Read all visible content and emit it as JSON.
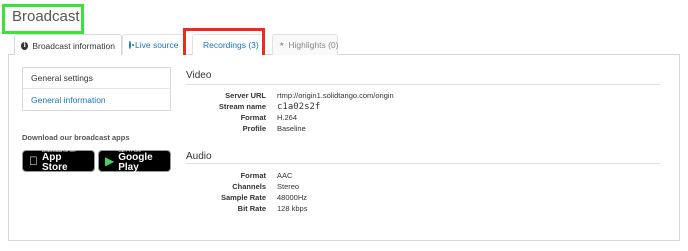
{
  "page": {
    "title": "Broadcast"
  },
  "tabs": [
    {
      "label": "Broadcast information",
      "icon": "info-icon",
      "state": "active"
    },
    {
      "label": "Live source",
      "icon": "live-source-icon",
      "state": "link"
    },
    {
      "label": "Recordings (3)",
      "icon": "recordings-icon",
      "state": "link"
    },
    {
      "label": "Highlights (0)",
      "icon": "star-icon",
      "state": "disabled"
    }
  ],
  "sidebar": {
    "items": [
      {
        "label": "General settings"
      },
      {
        "label": "General information"
      }
    ]
  },
  "apps": {
    "title": "Download our broadcast apps",
    "apple": {
      "small": "Download on the",
      "big": "App Store"
    },
    "google": {
      "small": "GET IT ON",
      "big": "Google Play"
    }
  },
  "video": {
    "title": "Video",
    "rows": [
      {
        "key": "Server URL",
        "value": "rtmp://origin1.solidtango.com/origin"
      },
      {
        "key": "Stream name",
        "value": "c1a02s2f"
      },
      {
        "key": "Format",
        "value": "H.264"
      },
      {
        "key": "Profile",
        "value": "Baseline"
      }
    ]
  },
  "audio": {
    "title": "Audio",
    "rows": [
      {
        "key": "Format",
        "value": "AAC"
      },
      {
        "key": "Channels",
        "value": "Stereo"
      },
      {
        "key": "Sample Rate",
        "value": "48000Hz"
      },
      {
        "key": "Bit Rate",
        "value": "128 kbps"
      }
    ]
  },
  "colors": {
    "link": "#1b75bb",
    "highlight_green": "#3ae23a",
    "highlight_red": "#ee2a1e"
  }
}
